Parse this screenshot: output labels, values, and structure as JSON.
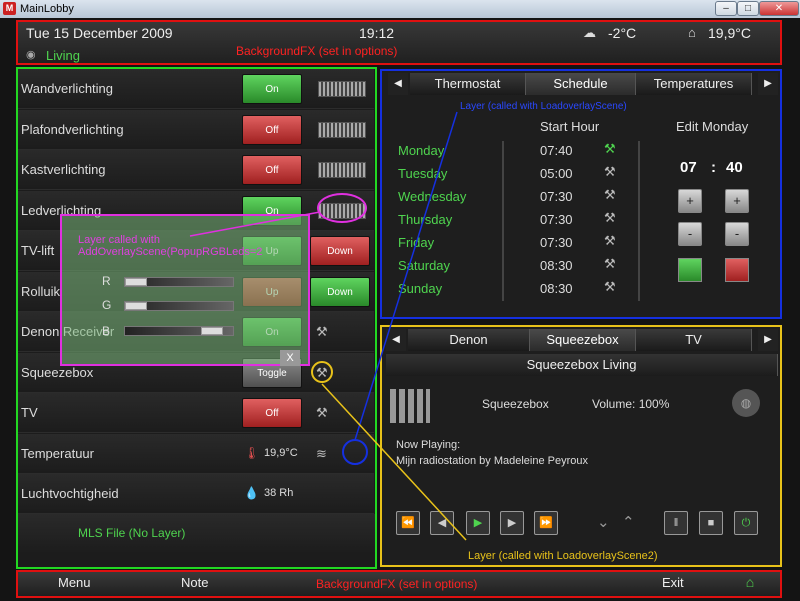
{
  "window": {
    "app_icon": "M",
    "title": "MainLobby",
    "min": "–",
    "max": "□",
    "close": "✕"
  },
  "header": {
    "date": "Tue 15 December 2009",
    "time": "19:12",
    "outdoor_temp": "-2°C",
    "indoor_temp": "19,9°C",
    "room": "Living",
    "bgfx_note": "BackgroundFX (set in options)"
  },
  "devices": [
    {
      "name": "Wandverlichting",
      "btn": "On",
      "state": "on"
    },
    {
      "name": "Plafondverlichting",
      "btn": "Off",
      "state": "off"
    },
    {
      "name": "Kastverlichting",
      "btn": "Off",
      "state": "off"
    },
    {
      "name": "Ledverlichting",
      "btn": "On",
      "state": "on"
    },
    {
      "name": "TV-lift",
      "btn": "Up",
      "state": "on",
      "btn2": "Down"
    },
    {
      "name": "Rolluik",
      "btn": "Up",
      "state": "off",
      "btn2": "Down"
    },
    {
      "name": "Denon Receiver",
      "btn": "On",
      "state": "on"
    },
    {
      "name": "Squeezebox",
      "btn": "Toggle",
      "state": "gray"
    },
    {
      "name": "TV",
      "btn": "Off",
      "state": "off"
    },
    {
      "name": "Temperatuur",
      "value": "19,9°C"
    },
    {
      "name": "Luchtvochtigheid",
      "value": "38 Rh"
    }
  ],
  "mls_note": "MLS File (No Layer)",
  "rgb_overlay": {
    "note_line1": "Layer called with",
    "note_line2": "AddOverlayScene(PopupRGBLeds=2",
    "close": "X",
    "labels": [
      "R",
      "G",
      "B"
    ]
  },
  "thermostat": {
    "tabs": [
      "Thermostat",
      "Schedule",
      "Temperatures"
    ],
    "layer_note": "Layer (called with LoadoverlayScene)",
    "start_hour": "Start Hour",
    "edit_label": "Edit Monday",
    "edit_hour": "07",
    "edit_sep": ":",
    "edit_min": "40",
    "schedule": [
      {
        "day": "Monday",
        "time": "07:40"
      },
      {
        "day": "Tuesday",
        "time": "05:00"
      },
      {
        "day": "Wednesday",
        "time": "07:30"
      },
      {
        "day": "Thursday",
        "time": "07:30"
      },
      {
        "day": "Friday",
        "time": "07:30"
      },
      {
        "day": "Saturday",
        "time": "08:30"
      },
      {
        "day": "Sunday",
        "time": "08:30"
      }
    ],
    "plus": "+",
    "minus": "-"
  },
  "media": {
    "tabs": [
      "Denon",
      "Squeezebox",
      "TV"
    ],
    "subtitle": "Squeezebox Living",
    "player": "Squeezebox",
    "volume": "Volume: 100%",
    "now_playing": "Now Playing:",
    "track": "Mijn radiostation by Madeleine Peyroux",
    "layer_note": "Layer (called with LoadoverlayScene2)"
  },
  "bottom": {
    "menu": "Menu",
    "note": "Note",
    "bgfx_note": "BackgroundFX (set in options)",
    "exit": "Exit"
  },
  "colors": {
    "accent_green": "#4fd44f",
    "alert_red": "#e01010"
  }
}
